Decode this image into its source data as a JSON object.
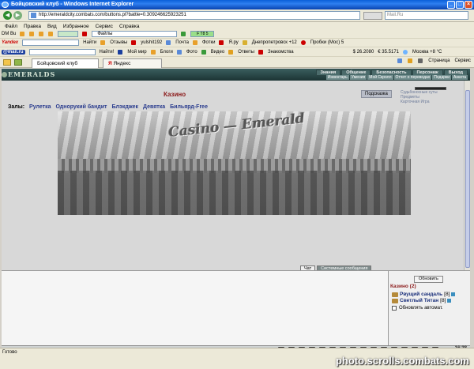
{
  "window": {
    "title": "Бойцовский клуб - Windows Internet Explorer",
    "minimize": "_",
    "maximize": "□",
    "close": "×"
  },
  "address": {
    "url": "http://emeraldcity.combats.com/buttons.pl?battle=0.309246625923251",
    "search_placeholder": "Mail.Ru"
  },
  "menu": [
    "Файл",
    "Правка",
    "Вид",
    "Избранное",
    "Сервис",
    "Справка"
  ],
  "toolbar1": {
    "dm_label": "DM Bu",
    "files_label": "Файлы",
    "ft_label": "F T8 5",
    "find_label": "Найти"
  },
  "toolbar2": {
    "yandex": "Yandex",
    "find": "Найти",
    "reviews": "Отзывы",
    "user": "yulshit192",
    "mail": "Почта",
    "photos": "Фотки",
    "yaru": "Я.ру",
    "city": "Днепропетровск +12",
    "traffic": "Пробки (Мос) 5"
  },
  "toolbar3": {
    "mailru": "@mail.ru",
    "find": "Найти!",
    "myworld": "Мой мир",
    "blogs": "Блоги",
    "photo": "Фото",
    "video": "Видео",
    "answers": "Ответы",
    "dating": "Знакомства",
    "rate1": "$ 26.2080",
    "rate2": "€ 35.5171",
    "weather": "Москва +8 °C"
  },
  "tabs": {
    "active": "Бойцовский клуб",
    "second": "Яндекс",
    "page": "Страница",
    "service": "Сервис"
  },
  "game": {
    "logo": "EMERALDS",
    "topnav": [
      "Знания",
      "Общение",
      "Безопасность",
      "Персонаж",
      "Выход"
    ],
    "subnav": [
      "Инвентарь",
      "Умения",
      "Мой Скролл",
      "Отчет о переводах",
      "Подарки",
      "Анкета"
    ],
    "casino_title": "Казино",
    "hint_button": "Подсказка",
    "side_links": [
      "Судьбоносные суты",
      "Предметы",
      "Карточная Игра"
    ],
    "halls_label": "Залы:",
    "halls": [
      "Рулетка",
      "Однорукий бандит",
      "Блэкджек",
      "Девятка",
      "Бильярд-Free"
    ],
    "banner_title": "Casino — Emerald"
  },
  "chat": {
    "tab_chat": "Чат",
    "tab_system": "Системные сообщения"
  },
  "online": {
    "refresh": "Обновить",
    "title": "Казино (2)",
    "users": [
      {
        "name": "Рвущий сандаль",
        "level": "[8]"
      },
      {
        "name": "Светлый Титан",
        "level": "[8]"
      }
    ],
    "auto_update": "Обновлять автомат."
  },
  "bottombar": {
    "clock": "16:38"
  },
  "status": {
    "text": "Готово",
    "watermark": "photo.scrolls.combats.com"
  }
}
